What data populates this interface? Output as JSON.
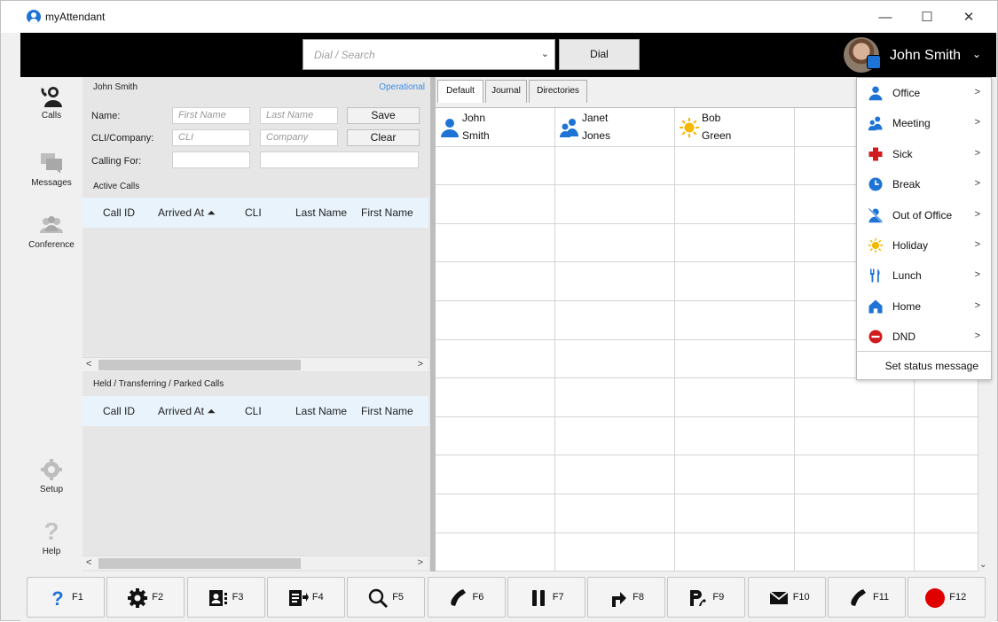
{
  "window": {
    "title": "myAttendant",
    "controls": {
      "minimize": "—",
      "maximize": "☐",
      "close": "✕"
    }
  },
  "header": {
    "search_placeholder": "Dial / Search",
    "dial_label": "Dial",
    "user_name": "John Smith",
    "user_chevron": "⌄"
  },
  "sidebar": {
    "items": [
      {
        "label": "Calls",
        "icon": "calls-icon"
      },
      {
        "label": "Messages",
        "icon": "messages-icon"
      },
      {
        "label": "Conference",
        "icon": "conference-icon"
      },
      {
        "label": "Setup",
        "icon": "gear-icon"
      },
      {
        "label": "Help",
        "icon": "help-icon"
      }
    ]
  },
  "caller_panel": {
    "owner_name": "John Smith",
    "status": "Operational",
    "name_label": "Name:",
    "first_name_placeholder": "First Name",
    "last_name_placeholder": "Last Name",
    "save_label": "Save",
    "cli_label": "CLI/Company:",
    "cli_placeholder": "CLI",
    "company_placeholder": "Company",
    "clear_label": "Clear",
    "calling_for_label": "Calling For:"
  },
  "active_calls": {
    "title": "Active Calls",
    "columns": [
      "Call ID",
      "Arrived At ⏶",
      "CLI",
      "Last Name",
      "First Name"
    ]
  },
  "held_calls": {
    "title": "Held / Transferring / Parked Calls",
    "columns": [
      "Call ID",
      "Arrived At ⏶",
      "CLI",
      "Last Name",
      "First Name"
    ]
  },
  "scroll": {
    "left": "<",
    "right": ">"
  },
  "tabs": [
    "Default",
    "Journal",
    "Directories"
  ],
  "contacts": [
    {
      "first": "John",
      "last": "Smith",
      "status": "office",
      "color": "#1e73d6"
    },
    {
      "first": "Janet",
      "last": "Jones",
      "status": "meeting",
      "color": "#1e73d6"
    },
    {
      "first": "Bob",
      "last": "Green",
      "status": "holiday",
      "color": "#f5b800"
    }
  ],
  "status_menu": {
    "items": [
      {
        "label": "Office",
        "icon": "office-icon",
        "color": "#1e73d6"
      },
      {
        "label": "Meeting",
        "icon": "meeting-icon",
        "color": "#1e73d6"
      },
      {
        "label": "Sick",
        "icon": "sick-cross-icon",
        "color": "#d01c1c"
      },
      {
        "label": "Break",
        "icon": "clock-icon",
        "color": "#1e73d6"
      },
      {
        "label": "Out of Office",
        "icon": "out-of-office-icon",
        "color": "#1e73d6"
      },
      {
        "label": "Holiday",
        "icon": "sun-icon",
        "color": "#f5b800"
      },
      {
        "label": "Lunch",
        "icon": "cutlery-icon",
        "color": "#1e73d6"
      },
      {
        "label": "Home",
        "icon": "home-icon",
        "color": "#1e73d6"
      },
      {
        "label": "DND",
        "icon": "dnd-icon",
        "color": "#d01c1c"
      }
    ],
    "arrow": ">",
    "set_status_label": "Set status message"
  },
  "fkeys": [
    {
      "label": "F1",
      "icon": "help-icon"
    },
    {
      "label": "F2",
      "icon": "gear-icon"
    },
    {
      "label": "F3",
      "icon": "contact-card-icon"
    },
    {
      "label": "F4",
      "icon": "transfer-card-icon"
    },
    {
      "label": "F5",
      "icon": "search-icon"
    },
    {
      "label": "F6",
      "icon": "phone-icon"
    },
    {
      "label": "F7",
      "icon": "pause-icon"
    },
    {
      "label": "F8",
      "icon": "forward-arrow-icon"
    },
    {
      "label": "F9",
      "icon": "park-icon"
    },
    {
      "label": "F10",
      "icon": "mail-icon"
    },
    {
      "label": "F11",
      "icon": "phone-icon"
    },
    {
      "label": "F12",
      "icon": "record-icon"
    }
  ],
  "colors": {
    "accent": "#1e73d6",
    "operational": "#3a8ee6",
    "grid_header": "#e8f3fc",
    "record": "#e00000"
  }
}
